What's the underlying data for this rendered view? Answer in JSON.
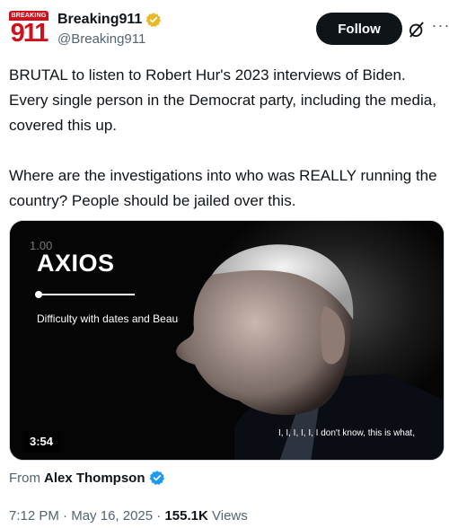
{
  "author": {
    "logo_top": "BREAKING",
    "logo_num": "911",
    "display_name": "Breaking911",
    "handle": "@Breaking911",
    "verified_color": "#e8b829"
  },
  "actions": {
    "follow_label": "Follow",
    "grok_icon": "grok-icon",
    "more_icon": "more-icon"
  },
  "tweet": {
    "text": "BRUTAL to listen to Robert Hur's 2023 interviews of Biden. Every single person in the Democrat party, including the media, covered this up.\n\nWhere are the investigations into who was REALLY running the country? People should be jailed over this."
  },
  "media": {
    "rate": "1.00",
    "logo": "AXIOS",
    "subtitle": "Difficulty with dates and Beau",
    "caption": "I, I, I, I, I, I don't know, this is what,",
    "duration": "3:54"
  },
  "attribution": {
    "from_label": "From",
    "name": "Alex Thompson",
    "verified_color": "#1d9bf0"
  },
  "meta": {
    "time": "7:12 PM",
    "separator": "·",
    "date": "May 16, 2025",
    "views_count": "155.1K",
    "views_label": "Views"
  },
  "colors": {
    "text": "#0f1419",
    "secondary": "#536471",
    "brand_red": "#d0111b"
  }
}
